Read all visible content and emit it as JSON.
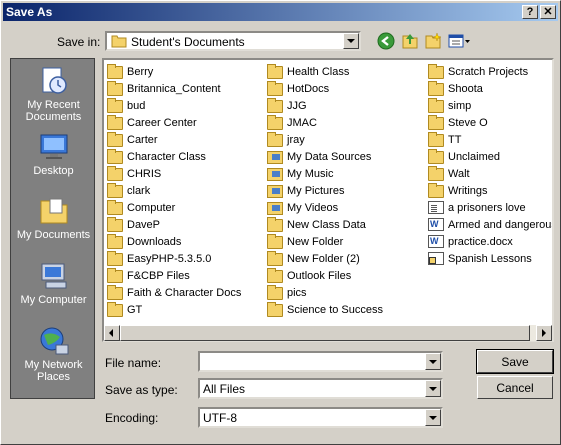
{
  "window": {
    "title": "Save As",
    "help_glyph": "?",
    "close_glyph": "✕"
  },
  "toolbar": {
    "save_in_label": "Save in:",
    "save_in_value": "Student's Documents"
  },
  "places": [
    {
      "label_line1": "My Recent",
      "label_line2": "Documents",
      "icon": "recent-documents-icon"
    },
    {
      "label_line1": "Desktop",
      "label_line2": "",
      "icon": "desktop-icon"
    },
    {
      "label_line1": "My Documents",
      "label_line2": "",
      "icon": "my-documents-icon"
    },
    {
      "label_line1": "My Computer",
      "label_line2": "",
      "icon": "my-computer-icon"
    },
    {
      "label_line1": "My Network",
      "label_line2": "Places",
      "icon": "network-places-icon"
    }
  ],
  "files": {
    "col1": [
      {
        "name": "Berry",
        "type": "folder"
      },
      {
        "name": "Britannica_Content",
        "type": "folder"
      },
      {
        "name": "bud",
        "type": "folder"
      },
      {
        "name": "Career Center",
        "type": "folder"
      },
      {
        "name": "Carter",
        "type": "folder"
      },
      {
        "name": "Character Class",
        "type": "folder"
      },
      {
        "name": "CHRIS",
        "type": "folder"
      },
      {
        "name": "clark",
        "type": "folder"
      },
      {
        "name": "Computer",
        "type": "folder"
      },
      {
        "name": "DaveP",
        "type": "folder"
      },
      {
        "name": "Downloads",
        "type": "folder"
      },
      {
        "name": "EasyPHP-5.3.5.0",
        "type": "folder"
      },
      {
        "name": "F&CBP Files",
        "type": "folder"
      },
      {
        "name": "Faith & Character Docs",
        "type": "folder"
      },
      {
        "name": "GT",
        "type": "folder"
      }
    ],
    "col2": [
      {
        "name": "Health Class",
        "type": "folder"
      },
      {
        "name": "HotDocs",
        "type": "folder"
      },
      {
        "name": "JJG",
        "type": "folder"
      },
      {
        "name": "JMAC",
        "type": "folder"
      },
      {
        "name": "jray",
        "type": "folder"
      },
      {
        "name": "My Data Sources",
        "type": "special"
      },
      {
        "name": "My Music",
        "type": "special"
      },
      {
        "name": "My Pictures",
        "type": "special"
      },
      {
        "name": "My Videos",
        "type": "special"
      },
      {
        "name": "New Class Data",
        "type": "folder"
      },
      {
        "name": "New Folder",
        "type": "folder"
      },
      {
        "name": "New Folder (2)",
        "type": "folder"
      },
      {
        "name": "Outlook Files",
        "type": "folder"
      },
      {
        "name": "pics",
        "type": "folder"
      },
      {
        "name": "Science to Success",
        "type": "folder"
      }
    ],
    "col3": [
      {
        "name": "Scratch Projects",
        "type": "folder"
      },
      {
        "name": "Shoota",
        "type": "folder"
      },
      {
        "name": "simp",
        "type": "folder"
      },
      {
        "name": "Steve O",
        "type": "folder"
      },
      {
        "name": "TT",
        "type": "folder"
      },
      {
        "name": "Unclaimed",
        "type": "folder"
      },
      {
        "name": "Walt",
        "type": "folder"
      },
      {
        "name": "Writings",
        "type": "folder"
      },
      {
        "name": "a prisoners love",
        "type": "file"
      },
      {
        "name": "Armed and dangerous",
        "type": "doc"
      },
      {
        "name": "practice.docx",
        "type": "doc"
      },
      {
        "name": "Spanish Lessons",
        "type": "shortcut"
      }
    ]
  },
  "form": {
    "file_name_label": "File name:",
    "file_name_value": "",
    "save_as_type_label": "Save as type:",
    "save_as_type_value": "All Files",
    "encoding_label": "Encoding:",
    "encoding_value": "UTF-8"
  },
  "buttons": {
    "save": "Save",
    "cancel": "Cancel"
  }
}
